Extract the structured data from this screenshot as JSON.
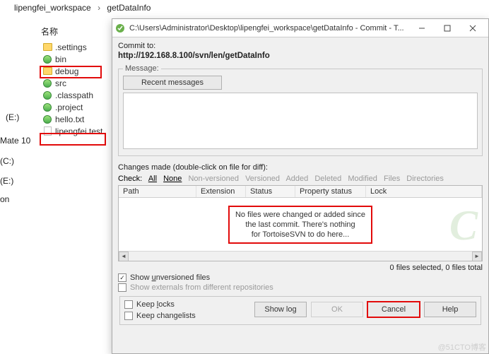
{
  "breadcrumb": {
    "item1": "lipengfei_workspace",
    "sep": "›",
    "item2": "getDataInfo"
  },
  "labels": {
    "name_heading": "名称",
    "E1": "(E:)",
    "Mate": "Mate 10",
    "C": "(C:)",
    "E2": "(E:)",
    "on": "on"
  },
  "tree": {
    "items": [
      {
        "label": ".settings",
        "icon": "folder"
      },
      {
        "label": "bin",
        "icon": "globe"
      },
      {
        "label": "debug",
        "icon": "folder"
      },
      {
        "label": "src",
        "icon": "globe"
      },
      {
        "label": ".classpath",
        "icon": "globe"
      },
      {
        "label": ".project",
        "icon": "globe"
      },
      {
        "label": "hello.txt",
        "icon": "globe"
      },
      {
        "label": "lipengfei.test",
        "icon": "doc"
      }
    ]
  },
  "dialog": {
    "title": "C:\\Users\\Administrator\\Desktop\\lipengfei_workspace\\getDataInfo - Commit - T...",
    "commit_to_label": "Commit to:",
    "url": "http://192.168.8.100/svn/len/getDataInfo",
    "message_legend": "Message:",
    "recent_btn": "Recent messages",
    "message_value": "",
    "changes_label": "Changes made (double-click on file for diff):",
    "check_label": "Check:",
    "check_all": "All",
    "check_none": "None",
    "check_nonversioned": "Non-versioned",
    "check_versioned": "Versioned",
    "check_added": "Added",
    "check_deleted": "Deleted",
    "check_modified": "Modified",
    "check_files": "Files",
    "check_dirs": "Directories",
    "grid": {
      "col_path": "Path",
      "col_ext": "Extension",
      "col_status": "Status",
      "col_prop": "Property status",
      "col_lock": "Lock",
      "empty_msg": "No files were changed or added since\nthe last commit. There's nothing\nfor TortoiseSVN to do here..."
    },
    "status_txt": "0 files selected, 0 files total",
    "show_unversioned": "Show unversioned files",
    "show_externals": "Show externals from different repositories",
    "flow_legend": "",
    "keep_locks": "Keep locks",
    "keep_changelists": "Keep changelists",
    "btn_showlog": "Show log",
    "btn_ok": "OK",
    "btn_cancel": "Cancel",
    "btn_help": "Help"
  },
  "watermark": "@51CTO博客"
}
